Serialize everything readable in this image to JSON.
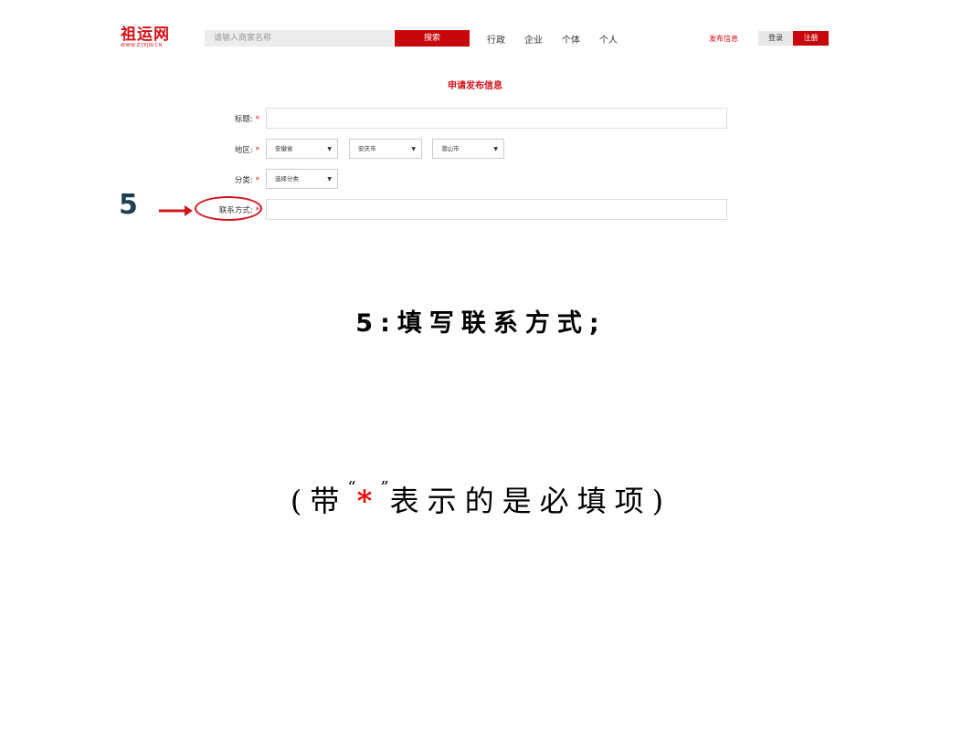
{
  "header": {
    "logo": "祖运网",
    "logo_sub": "WWW.ZYPJW.CN",
    "search_placeholder": "请输入商家名称",
    "search_button": "搜索",
    "nav": [
      "行政",
      "企业",
      "个体",
      "个人"
    ],
    "publish_link": "发布信息",
    "login": "登录",
    "register": "注册"
  },
  "form": {
    "title": "申请发布信息",
    "required_mark": "*",
    "fields": {
      "title_label": "标题:",
      "region_label": "地区:",
      "category_label": "分类:",
      "contact_label": "联系方式:"
    },
    "region": {
      "province": "安徽省",
      "city": "安庆市",
      "district": "潜山市"
    },
    "category": {
      "selected": "选择分类"
    }
  },
  "annotation": {
    "step_number": "5",
    "caption": "5:填写联系方式;",
    "note_prefix": "(带",
    "note_open_quote": "“",
    "note_star": "*",
    "note_close_quote": "”",
    "note_suffix": "表示的是必填项)",
    "colors": {
      "highlight": "#d0151c",
      "step_number": "#1d3f52",
      "brand": "#d40f16"
    }
  }
}
